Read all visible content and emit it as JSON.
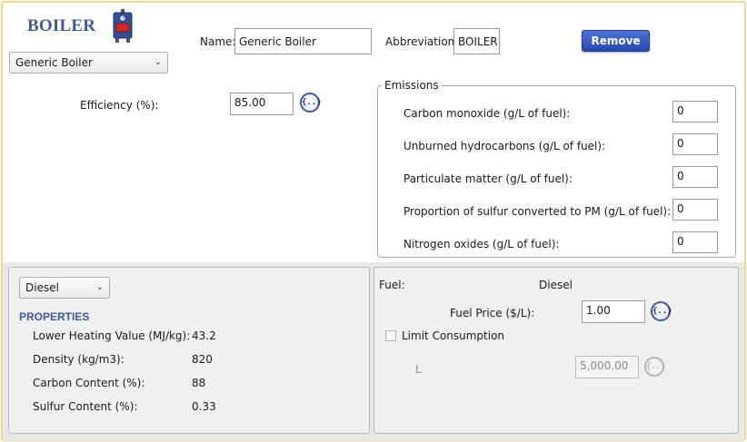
{
  "header": {
    "title": "BOILER",
    "icon": "boiler-icon",
    "name_label": "Name:",
    "name_value": "Generic Boiler",
    "abbreviation_label": "Abbreviation:",
    "abbreviation_value": "BOILER",
    "remove_label": "Remove",
    "type_select": "Generic Boiler"
  },
  "efficiency": {
    "label": "Efficiency (%):",
    "value": "85.00",
    "fx_label": "{..}"
  },
  "emissions": {
    "title": "Emissions",
    "rows": [
      {
        "label": "Carbon monoxide (g/L of fuel):",
        "value": "0"
      },
      {
        "label": "Unburned hydrocarbons (g/L of fuel):",
        "value": "0"
      },
      {
        "label": "Particulate matter (g/L of fuel):",
        "value": "0"
      },
      {
        "label": "Proportion of sulfur converted to PM (g/L of fuel):",
        "value": "0"
      },
      {
        "label": "Nitrogen oxides (g/L of fuel):",
        "value": "0"
      }
    ]
  },
  "fuel_properties": {
    "select": "Diesel",
    "title": "PROPERTIES",
    "rows": [
      {
        "label": "Lower Heating Value (MJ/kg):",
        "value": "43.2"
      },
      {
        "label": "Density (kg/m3):",
        "value": "820"
      },
      {
        "label": "Carbon Content (%):",
        "value": "88"
      },
      {
        "label": "Sulfur Content (%):",
        "value": "0.33"
      }
    ]
  },
  "fuel_panel": {
    "fuel_label": "Fuel:",
    "fuel_value": "Diesel",
    "price_label": "Fuel Price ($/L):",
    "price_value": "1.00",
    "price_fx": "{..}",
    "limit_label": "Limit Consumption",
    "limit_checked": false,
    "unit_label": "L",
    "limit_value": "5,000.00",
    "limit_fx": "{..}"
  },
  "colors": {
    "accent": "#3d5a9c",
    "button": "#2549b5",
    "frame": "#f2d98a"
  }
}
